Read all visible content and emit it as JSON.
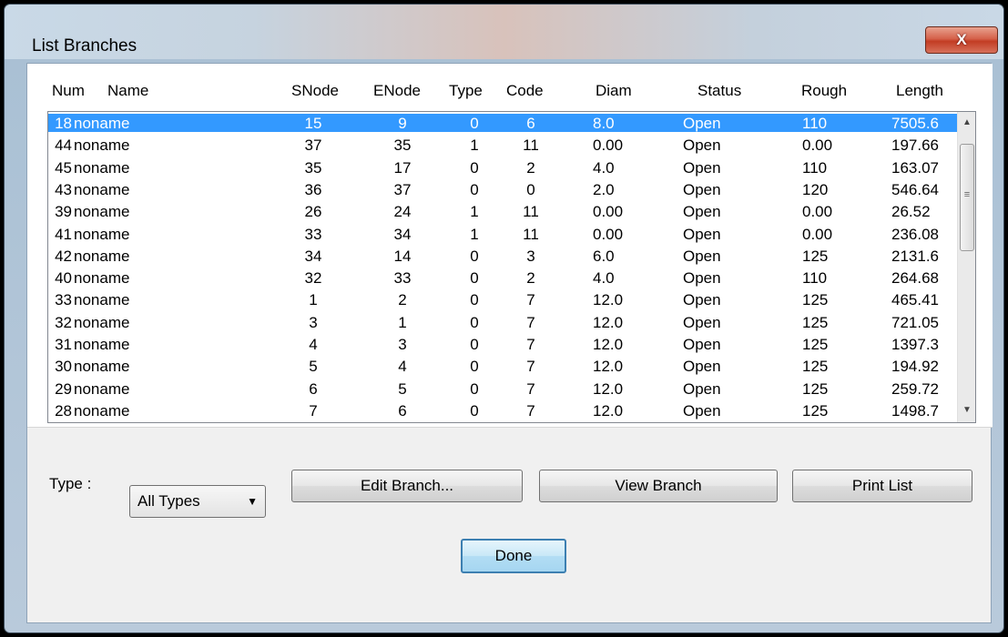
{
  "window": {
    "title": "List Branches",
    "close_glyph": "X"
  },
  "list": {
    "columns": [
      "Num",
      "Name",
      "SNode",
      "ENode",
      "Type",
      "Code",
      "Diam",
      "Status",
      "Rough",
      "Length"
    ],
    "rows": [
      [
        "18",
        "noname",
        "15",
        "9",
        "0",
        "6",
        "8.0",
        "Open",
        "110",
        "7505.6"
      ],
      [
        "44",
        "noname",
        "37",
        "35",
        "1",
        "11",
        "0.00",
        "Open",
        "0.00",
        "197.66"
      ],
      [
        "45",
        "noname",
        "35",
        "17",
        "0",
        "2",
        "4.0",
        "Open",
        "110",
        "163.07"
      ],
      [
        "43",
        "noname",
        "36",
        "37",
        "0",
        "0",
        "2.0",
        "Open",
        "120",
        "546.64"
      ],
      [
        "39",
        "noname",
        "26",
        "24",
        "1",
        "11",
        "0.00",
        "Open",
        "0.00",
        "26.52"
      ],
      [
        "41",
        "noname",
        "33",
        "34",
        "1",
        "11",
        "0.00",
        "Open",
        "0.00",
        "236.08"
      ],
      [
        "42",
        "noname",
        "34",
        "14",
        "0",
        "3",
        "6.0",
        "Open",
        "125",
        "2131.6"
      ],
      [
        "40",
        "noname",
        "32",
        "33",
        "0",
        "2",
        "4.0",
        "Open",
        "110",
        "264.68"
      ],
      [
        "33",
        "noname",
        "1",
        "2",
        "0",
        "7",
        "12.0",
        "Open",
        "125",
        "465.41"
      ],
      [
        "32",
        "noname",
        "3",
        "1",
        "0",
        "7",
        "12.0",
        "Open",
        "125",
        "721.05"
      ],
      [
        "31",
        "noname",
        "4",
        "3",
        "0",
        "7",
        "12.0",
        "Open",
        "125",
        "1397.3"
      ],
      [
        "30",
        "noname",
        "5",
        "4",
        "0",
        "7",
        "12.0",
        "Open",
        "125",
        "194.92"
      ],
      [
        "29",
        "noname",
        "6",
        "5",
        "0",
        "7",
        "12.0",
        "Open",
        "125",
        "259.72"
      ],
      [
        "28",
        "noname",
        "7",
        "6",
        "0",
        "7",
        "12.0",
        "Open",
        "125",
        "1498.7"
      ]
    ],
    "selected_index": 0
  },
  "controls": {
    "type_label": "Type :",
    "type_value": "All Types",
    "edit_label": "Edit Branch...",
    "view_label": "View Branch",
    "print_label": "Print List",
    "done_label": "Done"
  },
  "colors": {
    "selection": "#3399ff",
    "close_button": "#c23c23"
  },
  "icons": {
    "scroll_up": "scroll-up-arrow-icon",
    "scroll_down": "scroll-down-arrow-icon",
    "dropdown": "chevron-down-icon",
    "close": "close-icon"
  }
}
